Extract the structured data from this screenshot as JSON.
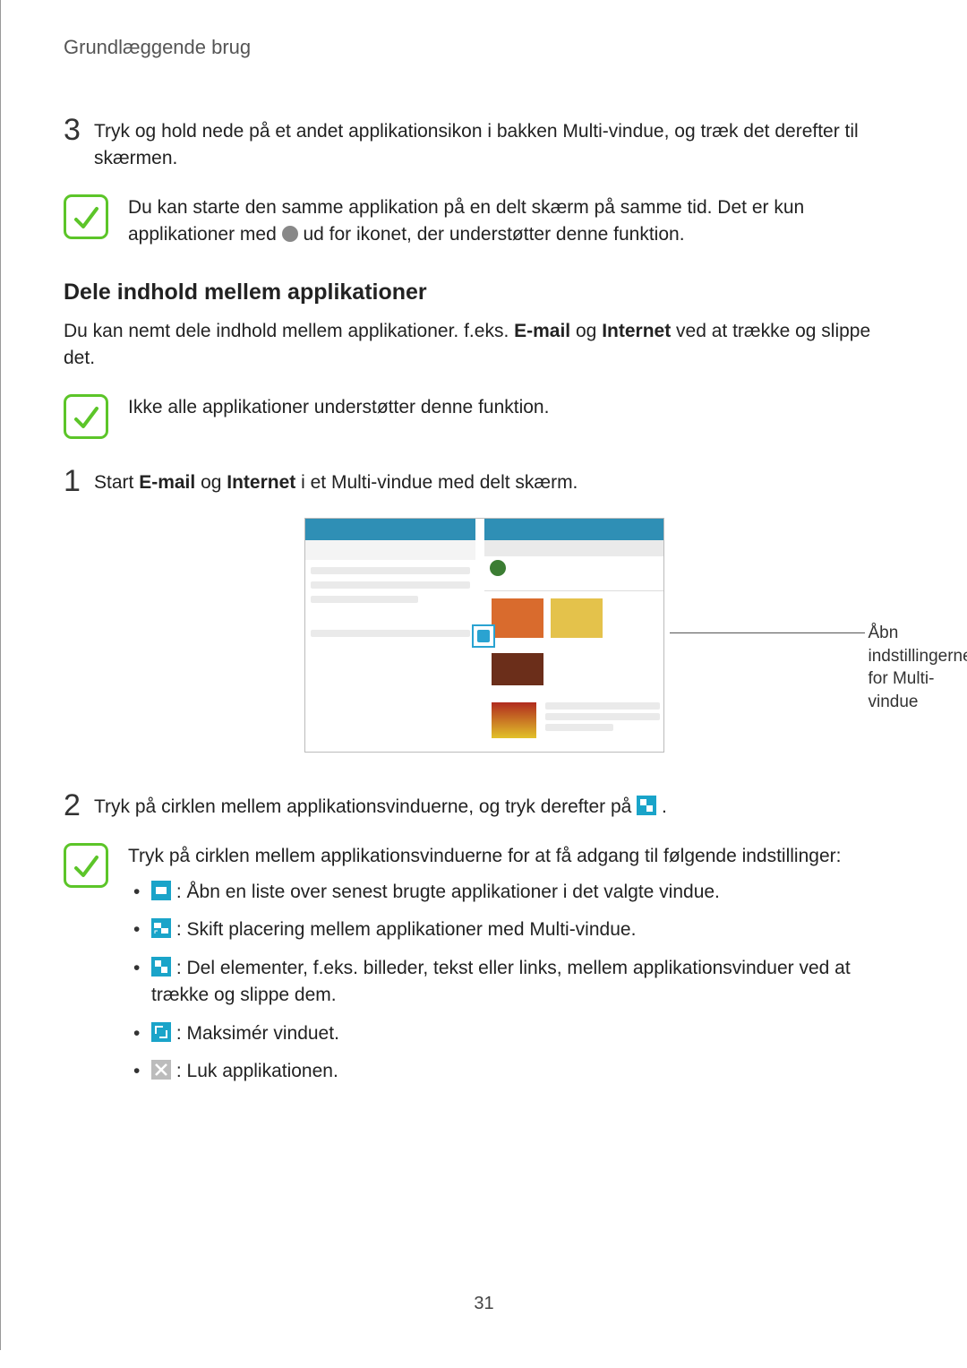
{
  "header": {
    "title": "Grundlæggende brug"
  },
  "step3": {
    "num": "3",
    "text": "Tryk og hold nede på et andet applikationsikon i bakken Multi-vindue, og træk det derefter til skærmen."
  },
  "note1": {
    "pre": "Du kan starte den samme applikation på en delt skærm på samme tid. Det er kun applikationer med ",
    "post": " ud for ikonet, der understøtter denne funktion."
  },
  "section": {
    "heading": "Dele indhold mellem applikationer"
  },
  "intro": {
    "pre": "Du kan nemt dele indhold mellem applikationer. f.eks. ",
    "b1": "E-mail",
    "mid": " og ",
    "b2": "Internet",
    "post": " ved at trække og slippe det."
  },
  "note2": {
    "text": "Ikke alle applikationer understøtter denne funktion."
  },
  "step1": {
    "num": "1",
    "pre": "Start ",
    "b1": "E-mail",
    "mid": " og ",
    "b2": "Internet",
    "post": " i et Multi-vindue med delt skærm."
  },
  "callout": {
    "text": "Åbn indstillingerne for Multi-vindue"
  },
  "step2": {
    "num": "2",
    "pre": "Tryk på cirklen mellem applikationsvinduerne, og tryk derefter på ",
    "post": "."
  },
  "note3": {
    "lead": "Tryk på cirklen mellem applikationsvinduerne for at få adgang til følgende indstillinger:",
    "items": [
      " : Åbn en liste over senest brugte applikationer i det valgte vindue.",
      " : Skift placering mellem applikationer med Multi-vindue.",
      " : Del elementer, f.eks. billeder, tekst eller links, mellem applikationsvinduer ved at trække og slippe dem.",
      " : Maksimér vinduet.",
      " : Luk applikationen."
    ]
  },
  "pageNumber": "31"
}
